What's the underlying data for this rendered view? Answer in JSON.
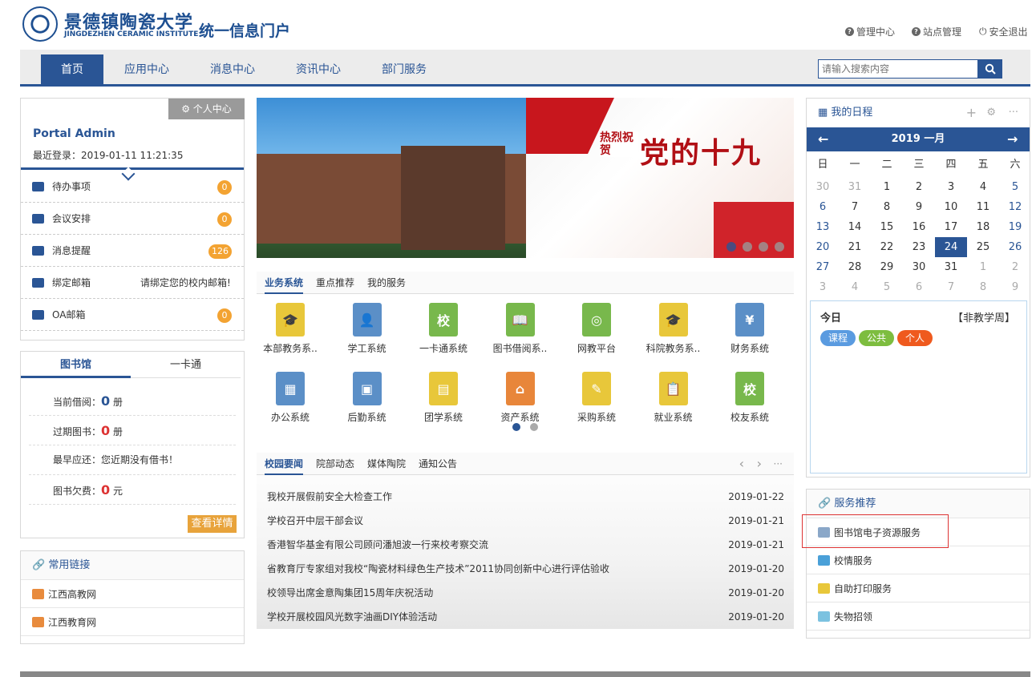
{
  "header": {
    "logo_cn": "景德镇陶瓷大学",
    "logo_en": "JINGDEZHEN CERAMIC INSTITUTE",
    "portal_title": "统一信息门户",
    "links": [
      "管理中心",
      "站点管理",
      "安全退出"
    ]
  },
  "nav": {
    "items": [
      "首页",
      "应用中心",
      "消息中心",
      "资讯中心",
      "部门服务"
    ],
    "search_placeholder": "请输入搜索内容"
  },
  "user": {
    "center_btn": "个人中心",
    "name": "Portal Admin",
    "last_login": "最近登录：2019-01-11 11:21:35",
    "items": [
      {
        "label": "待办事项",
        "badge": "0"
      },
      {
        "label": "会议安排",
        "badge": "0"
      },
      {
        "label": "消息提醒",
        "badge": "126"
      },
      {
        "label": "绑定邮箱",
        "note": "请绑定您的校内邮箱!"
      },
      {
        "label": "OA邮箱",
        "badge": "0"
      }
    ]
  },
  "library": {
    "tabs": [
      "图书馆",
      "一卡通"
    ],
    "rows": [
      {
        "label": "当前借阅：",
        "value": "0",
        "unit": " 册"
      },
      {
        "label": "过期图书：",
        "value": "0",
        "unit": " 册"
      },
      {
        "label": "最早应还：您近期没有借书！",
        "value": "",
        "unit": ""
      },
      {
        "label": "图书欠费：",
        "value": "0",
        "unit": " 元"
      }
    ],
    "detail_btn": "查看详情"
  },
  "links": {
    "title": "常用链接",
    "items": [
      "江西高教网",
      "江西教育网"
    ]
  },
  "biz": {
    "tabs": [
      "业务系统",
      "重点推荐",
      "我的服务"
    ],
    "systems": [
      {
        "label": "本部教务系..",
        "color": "#e8c73a",
        "glyph": "🎓"
      },
      {
        "label": "学工系统",
        "color": "#5b8fc7",
        "glyph": "👤"
      },
      {
        "label": "一卡通系统",
        "color": "#78b84c",
        "glyph": "校"
      },
      {
        "label": "图书借阅系..",
        "color": "#78b84c",
        "glyph": "📖"
      },
      {
        "label": "网教平台",
        "color": "#78b84c",
        "glyph": "◎"
      },
      {
        "label": "科院教务系..",
        "color": "#e8c73a",
        "glyph": "🎓"
      },
      {
        "label": "财务系统",
        "color": "#5b8fc7",
        "glyph": "¥"
      },
      {
        "label": "办公系统",
        "color": "#5b8fc7",
        "glyph": "▦"
      },
      {
        "label": "后勤系统",
        "color": "#5b8fc7",
        "glyph": "▣"
      },
      {
        "label": "团学系统",
        "color": "#e8c73a",
        "glyph": "▤"
      },
      {
        "label": "资产系统",
        "color": "#e8863a",
        "glyph": "⌂"
      },
      {
        "label": "采购系统",
        "color": "#e8c73a",
        "glyph": "✎"
      },
      {
        "label": "就业系统",
        "color": "#e8c73a",
        "glyph": "📋"
      },
      {
        "label": "校友系统",
        "color": "#78b84c",
        "glyph": "校"
      }
    ]
  },
  "news": {
    "tabs": [
      "校园要闻",
      "院部动态",
      "媒体陶院",
      "通知公告"
    ],
    "items": [
      {
        "title": "我校开展假前安全大检查工作",
        "date": "2019-01-22"
      },
      {
        "title": "学校召开中层干部会议",
        "date": "2019-01-21"
      },
      {
        "title": "香港智华基金有限公司顾问潘旭波一行来校考察交流",
        "date": "2019-01-21"
      },
      {
        "title": "省教育厅专家组对我校“陶瓷材料绿色生产技术”2011协同创新中心进行评估验收",
        "date": "2019-01-20"
      },
      {
        "title": "校领导出席金意陶集团15周年庆祝活动",
        "date": "2019-01-20"
      },
      {
        "title": "学校开展校园风光数字油画DIY体验活动",
        "date": "2019-01-20"
      }
    ]
  },
  "calendar": {
    "title": "我的日程",
    "month": "2019 一月",
    "weekdays": [
      "日",
      "一",
      "二",
      "三",
      "四",
      "五",
      "六"
    ],
    "days": [
      [
        "30",
        "31",
        "1",
        "2",
        "3",
        "4",
        "5"
      ],
      [
        "6",
        "7",
        "8",
        "9",
        "10",
        "11",
        "12"
      ],
      [
        "13",
        "14",
        "15",
        "16",
        "17",
        "18",
        "19"
      ],
      [
        "20",
        "21",
        "22",
        "23",
        "24",
        "25",
        "26"
      ],
      [
        "27",
        "28",
        "29",
        "30",
        "31",
        "1",
        "2"
      ],
      [
        "3",
        "4",
        "5",
        "6",
        "7",
        "8",
        "9"
      ]
    ],
    "today_label": "今日",
    "week_type": "【非教学周】",
    "tags": [
      {
        "label": "课程",
        "color": "#5a9be0"
      },
      {
        "label": "公共",
        "color": "#7dbd3f"
      },
      {
        "label": "个人",
        "color": "#ef5a1e"
      }
    ]
  },
  "services": {
    "title": "服务推荐",
    "items": [
      {
        "label": "图书馆电子资源服务",
        "color": "#8aa7c8"
      },
      {
        "label": "校情服务",
        "color": "#4aa0d8"
      },
      {
        "label": "自助打印服务",
        "color": "#e8c73a"
      },
      {
        "label": "失物招领",
        "color": "#7cc2e0"
      }
    ]
  },
  "banner": {
    "headline": "党的十九",
    "sub": "热烈祝贺"
  }
}
